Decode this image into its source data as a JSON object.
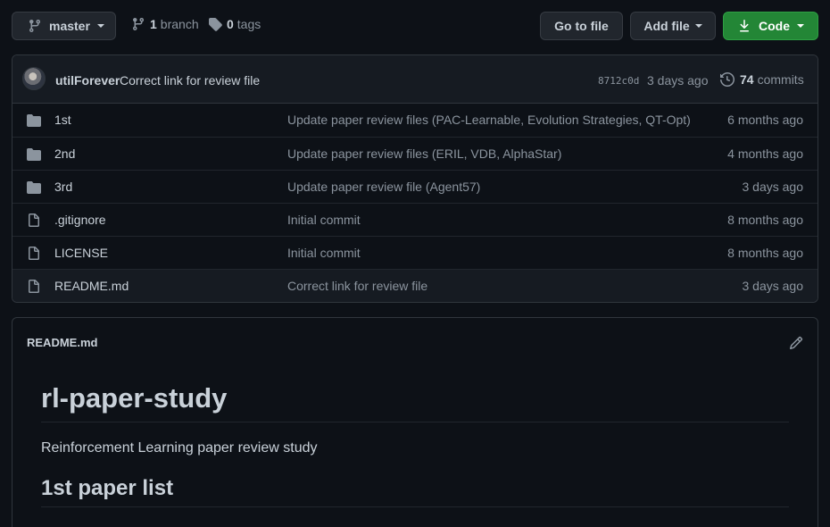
{
  "toolbar": {
    "branch_name": "master",
    "branch_count": "1",
    "branch_label": "branch",
    "tag_count": "0",
    "tag_label": "tags",
    "go_to_file": "Go to file",
    "add_file": "Add file",
    "code": "Code"
  },
  "commit": {
    "author": "utilForever",
    "message": "Correct link for review file",
    "sha": "8712c0d",
    "time": "3 days ago",
    "count": "74",
    "count_label": "commits"
  },
  "files": [
    {
      "type": "dir",
      "name": "1st",
      "message": "Update paper review files (PAC-Learnable, Evolution Strategies, QT-Opt)",
      "time": "6 months ago"
    },
    {
      "type": "dir",
      "name": "2nd",
      "message": "Update paper review files (ERIL, VDB, AlphaStar)",
      "time": "4 months ago"
    },
    {
      "type": "dir",
      "name": "3rd",
      "message": "Update paper review file (Agent57)",
      "time": "3 days ago"
    },
    {
      "type": "file",
      "name": ".gitignore",
      "message": "Initial commit",
      "time": "8 months ago"
    },
    {
      "type": "file",
      "name": "LICENSE",
      "message": "Initial commit",
      "time": "8 months ago"
    },
    {
      "type": "file",
      "name": "README.md",
      "message": "Correct link for review file",
      "time": "3 days ago"
    }
  ],
  "readme": {
    "filename": "README.md",
    "title": "rl-paper-study",
    "description": "Reinforcement Learning paper review study",
    "section": "1st paper list"
  },
  "colors": {
    "background": "#0d1117",
    "primary_button": "#238636",
    "folder_icon": "#8b949e"
  }
}
